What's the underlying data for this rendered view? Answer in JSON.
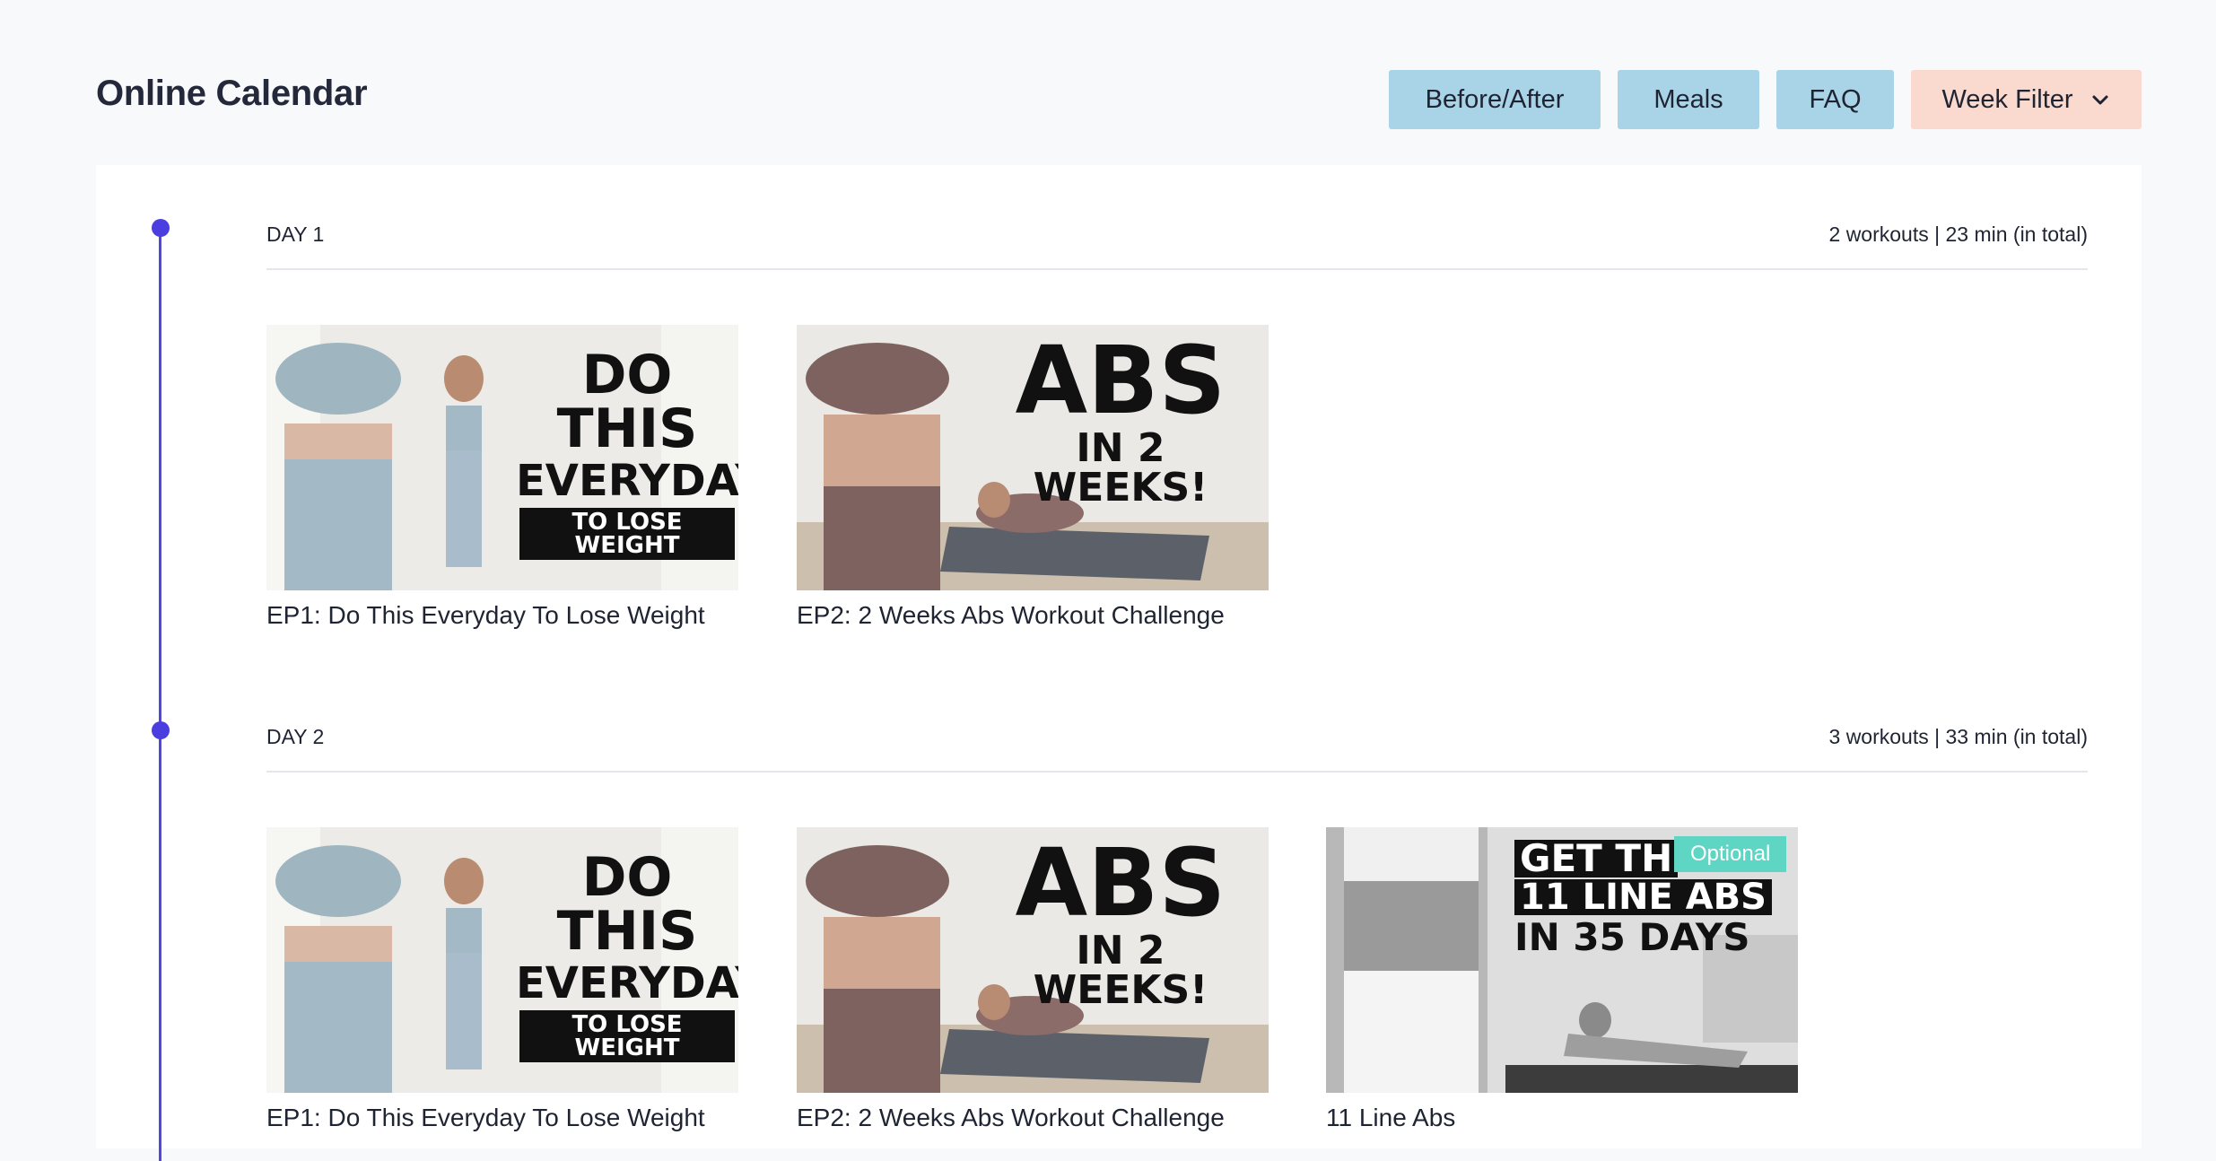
{
  "header": {
    "title": "Online Calendar",
    "buttons": {
      "before_after": "Before/After",
      "meals": "Meals",
      "faq": "FAQ",
      "week_filter": "Week Filter"
    }
  },
  "colors": {
    "accent": "#4a3ee0",
    "button_blue": "#a9d4e8",
    "button_pink": "#fad9cf",
    "badge": "#5fd6c4"
  },
  "days": [
    {
      "label": "DAY 1",
      "summary": "2 workouts | 23 min (in total)",
      "workouts": [
        {
          "title": "EP1: Do This Everyday To Lose Weight",
          "thumb_lines": [
            "DO THIS",
            "EVERYDAY",
            "TO LOSE WEIGHT"
          ]
        },
        {
          "title": "EP2: 2 Weeks Abs Workout Challenge",
          "thumb_lines": [
            "ABS",
            "IN 2 WEEKS!"
          ]
        }
      ]
    },
    {
      "label": "DAY 2",
      "summary": "3 workouts | 33 min (in total)",
      "workouts": [
        {
          "title": "EP1: Do This Everyday To Lose Weight",
          "thumb_lines": [
            "DO THIS",
            "EVERYDAY",
            "TO LOSE WEIGHT"
          ]
        },
        {
          "title": "EP2: 2 Weeks Abs Workout Challenge",
          "thumb_lines": [
            "ABS",
            "IN 2 WEEKS!"
          ]
        },
        {
          "title": "11 Line Abs",
          "badge": "Optional",
          "thumb_lines": [
            "GET TH",
            "11 LINE ABS",
            "IN 35 DAYS"
          ]
        }
      ]
    }
  ]
}
